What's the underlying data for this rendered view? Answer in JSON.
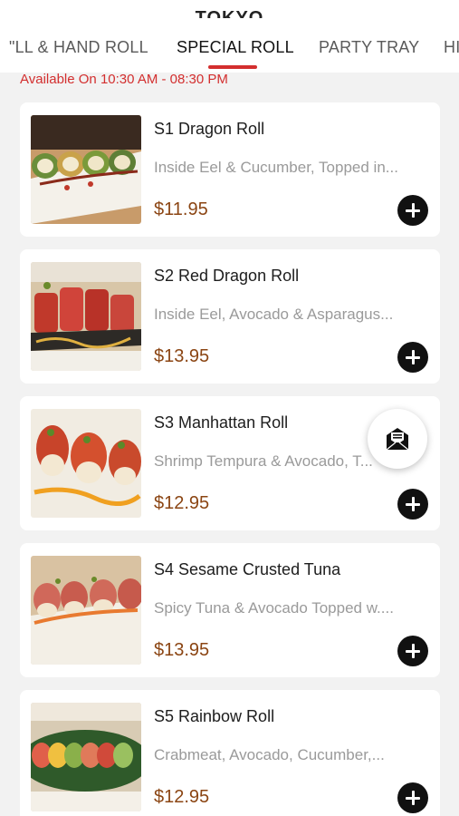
{
  "header": {
    "brand": "TOKYO"
  },
  "tabs": [
    {
      "label": "\"LL & HAND ROLL"
    },
    {
      "label": "SPECIAL ROLL"
    },
    {
      "label": "PARTY TRAY"
    },
    {
      "label": "HI"
    }
  ],
  "active_tab": "SPECIAL ROLL",
  "availability": "Available On 10:30 AM - 08:30 PM",
  "items": [
    {
      "name": "S1 Dragon Roll",
      "description": "Inside Eel & Cucumber, Topped in...",
      "price": "$11.95"
    },
    {
      "name": "S2 Red Dragon Roll",
      "description": "Inside Eel, Avocado & Asparagus...",
      "price": "$13.95"
    },
    {
      "name": "S3 Manhattan Roll",
      "description": "Shrimp Tempura & Avocado, T...",
      "price": "$12.95"
    },
    {
      "name": "S4 Sesame Crusted Tuna",
      "description": "Spicy Tuna & Avocado Topped w....",
      "price": "$13.95"
    },
    {
      "name": "S5 Rainbow Roll",
      "description": "Crabmeat, Avocado, Cucumber,...",
      "price": "$12.95"
    }
  ],
  "colors": {
    "accent": "#d32f2f",
    "price": "#8b4513",
    "background": "#f2f2f2",
    "card": "#ffffff"
  },
  "icons": {
    "add": "plus-circle-icon",
    "message": "envelope-icon"
  }
}
